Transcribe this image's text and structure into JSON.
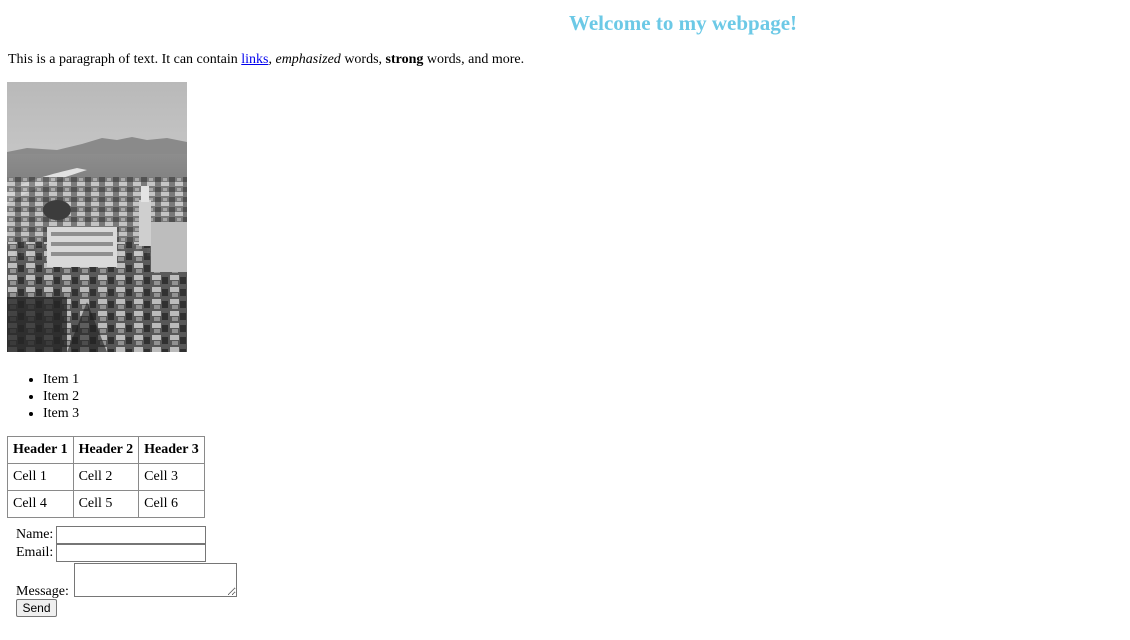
{
  "header": {
    "title": "Welcome to my webpage!"
  },
  "intro": {
    "text_before": "This is a paragraph of text. It can contain ",
    "link_text": "links",
    "text_comma": ", ",
    "emphasized_text": "emphasized",
    "text_middle": " words, ",
    "strong_text": "strong",
    "text_after": " words, and more."
  },
  "image": {
    "subject": "grayscale aerial view of a historic city with river and hills"
  },
  "list": {
    "items": [
      "Item 1",
      "Item 2",
      "Item 3"
    ]
  },
  "table": {
    "headers": [
      "Header 1",
      "Header 2",
      "Header 3"
    ],
    "rows": [
      [
        "Cell 1",
        "Cell 2",
        "Cell 3"
      ],
      [
        "Cell 4",
        "Cell 5",
        "Cell 6"
      ]
    ]
  },
  "form": {
    "name_label": "Name:",
    "name_value": "",
    "email_label": "Email:",
    "email_value": "",
    "message_label": "Message:",
    "message_value": "",
    "submit_label": "Send"
  },
  "colors": {
    "title": "#6cc9e6",
    "link": "#0000ee",
    "text": "#000000"
  }
}
